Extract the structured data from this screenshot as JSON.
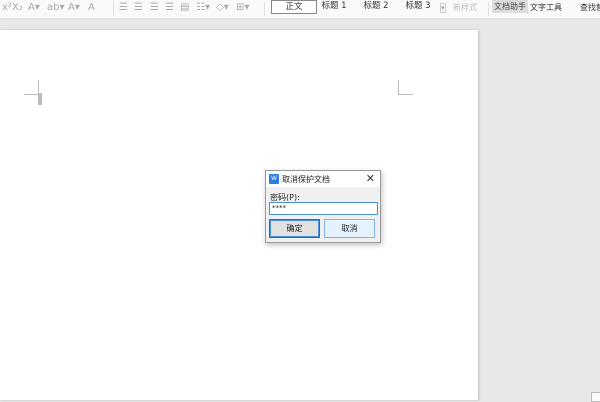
{
  "toolbar": {
    "icons": [
      "superscript-icon",
      "subscript-icon",
      "text-effect-icon",
      "highlight-icon",
      "font-color-icon",
      "char-shading-icon",
      "align-left-icon",
      "align-center-icon",
      "align-right-icon",
      "justify-icon",
      "distributed-icon",
      "line-spacing-icon",
      "shading-icon",
      "border-icon"
    ],
    "styles": [
      "正文",
      "标题 1",
      "标题 2",
      "标题 3"
    ],
    "new_style": "新样式",
    "doc_assistant": "文档助手",
    "text_tools": "文字工具",
    "find_replace": "查找替换"
  },
  "dialog": {
    "title": "取消保护文档",
    "password_label": "密码(P):",
    "password_value": "****",
    "ok": "确定",
    "cancel": "取消",
    "close": "✕",
    "app_icon": "W"
  }
}
